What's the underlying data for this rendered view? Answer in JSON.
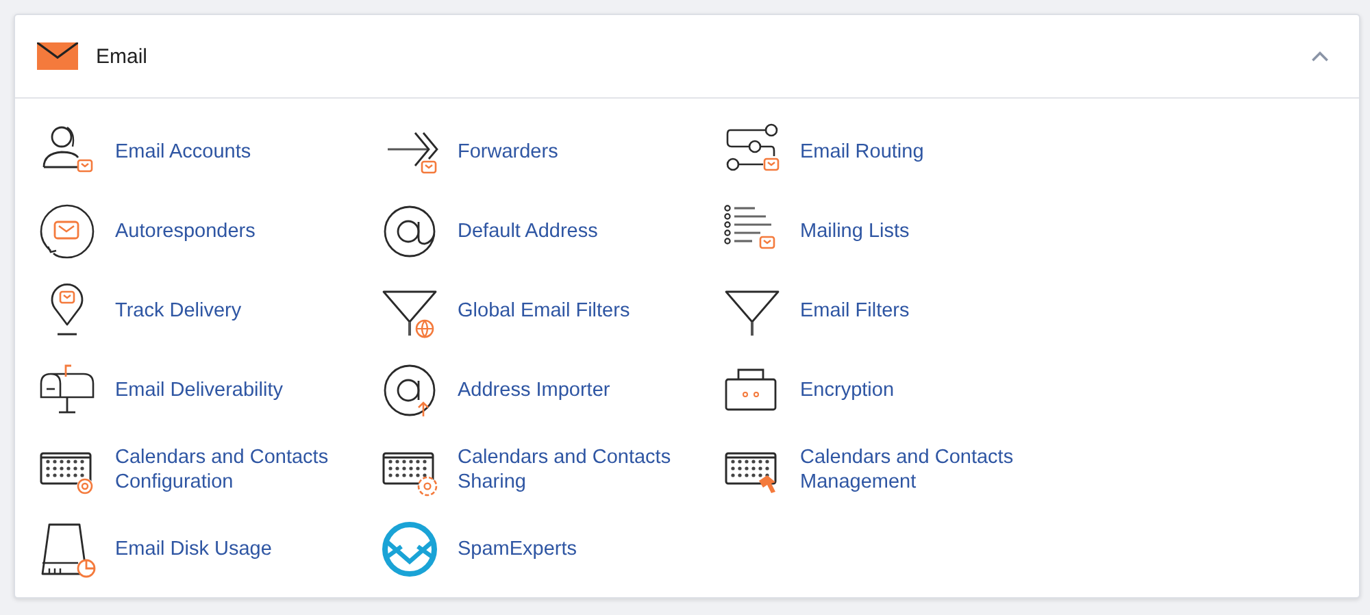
{
  "section": {
    "title": "Email",
    "expanded": true
  },
  "items": [
    {
      "label": "Email Accounts"
    },
    {
      "label": "Forwarders"
    },
    {
      "label": "Email Routing"
    },
    {
      "label": "Autoresponders"
    },
    {
      "label": "Default Address"
    },
    {
      "label": "Mailing Lists"
    },
    {
      "label": "Track Delivery"
    },
    {
      "label": "Global Email Filters"
    },
    {
      "label": "Email Filters"
    },
    {
      "label": "Email Deliverability"
    },
    {
      "label": "Address Importer"
    },
    {
      "label": "Encryption"
    },
    {
      "label": "Calendars and Contacts Configuration"
    },
    {
      "label": "Calendars and Contacts Sharing"
    },
    {
      "label": "Calendars and Contacts Management"
    },
    {
      "label": "Email Disk Usage"
    },
    {
      "label": "SpamExperts"
    }
  ]
}
